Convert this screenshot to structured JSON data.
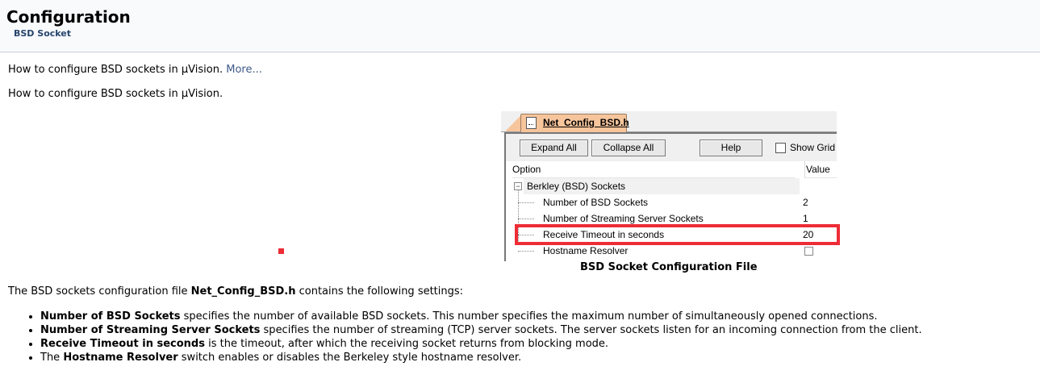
{
  "header": {
    "title": "Configuration",
    "subtitle": "BSD Socket"
  },
  "intro": {
    "text": "How to configure BSD sockets in µVision.",
    "more_link": "More..."
  },
  "intro2": "How to configure BSD sockets in µVision.",
  "figure": {
    "tab_label": "Net_Config_BSD.h",
    "buttons": {
      "expand": "Expand All",
      "collapse": "Collapse All",
      "help": "Help"
    },
    "show_grid_label": "Show Grid",
    "columns": {
      "option": "Option",
      "value": "Value"
    },
    "group": "Berkley (BSD) Sockets",
    "rows": [
      {
        "label": "Number of BSD Sockets",
        "value": "2"
      },
      {
        "label": "Number of Streaming Server Sockets",
        "value": "1"
      },
      {
        "label": "Receive Timeout in seconds",
        "value": "20"
      },
      {
        "label": "Hostname Resolver",
        "value": ""
      }
    ],
    "caption": "BSD Socket Configuration File",
    "highlight_color": "#ee2c36",
    "tab_color": "#f6c59c"
  },
  "body": {
    "file_intro_pre": "The BSD sockets configuration file ",
    "file_name": "Net_Config_BSD.h",
    "file_intro_post": " contains the following settings:",
    "bullets": [
      {
        "pre": "",
        "bold": "Number of BSD Sockets",
        "post": " specifies the number of available BSD sockets. This number specifies the maximum number of simultaneously opened connections."
      },
      {
        "pre": "",
        "bold": "Number of Streaming Server Sockets",
        "post": " specifies the number of streaming (TCP) server sockets. The server sockets listen for an incoming connection from the client."
      },
      {
        "pre": "",
        "bold": "Receive Timeout in seconds",
        "post": " is the timeout, after which the receiving socket returns from blocking mode."
      },
      {
        "pre": "The ",
        "bold": "Hostname Resolver",
        "post": " switch enables or disables the Berkeley style hostname resolver."
      }
    ]
  }
}
